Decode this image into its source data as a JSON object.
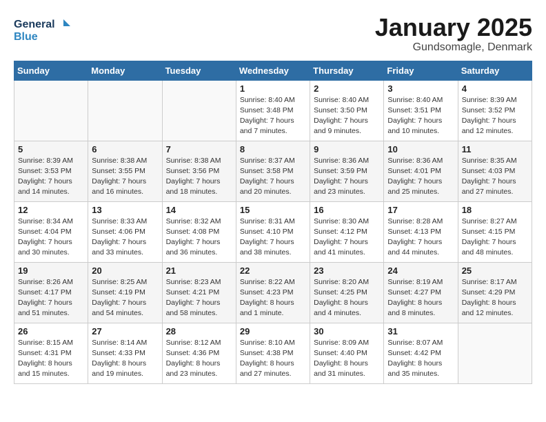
{
  "header": {
    "logo_line1": "General",
    "logo_line2": "Blue",
    "title": "January 2025",
    "subtitle": "Gundsomagle, Denmark"
  },
  "weekdays": [
    "Sunday",
    "Monday",
    "Tuesday",
    "Wednesday",
    "Thursday",
    "Friday",
    "Saturday"
  ],
  "weeks": [
    [
      {
        "day": "",
        "info": ""
      },
      {
        "day": "",
        "info": ""
      },
      {
        "day": "",
        "info": ""
      },
      {
        "day": "1",
        "info": "Sunrise: 8:40 AM\nSunset: 3:48 PM\nDaylight: 7 hours\nand 7 minutes."
      },
      {
        "day": "2",
        "info": "Sunrise: 8:40 AM\nSunset: 3:50 PM\nDaylight: 7 hours\nand 9 minutes."
      },
      {
        "day": "3",
        "info": "Sunrise: 8:40 AM\nSunset: 3:51 PM\nDaylight: 7 hours\nand 10 minutes."
      },
      {
        "day": "4",
        "info": "Sunrise: 8:39 AM\nSunset: 3:52 PM\nDaylight: 7 hours\nand 12 minutes."
      }
    ],
    [
      {
        "day": "5",
        "info": "Sunrise: 8:39 AM\nSunset: 3:53 PM\nDaylight: 7 hours\nand 14 minutes."
      },
      {
        "day": "6",
        "info": "Sunrise: 8:38 AM\nSunset: 3:55 PM\nDaylight: 7 hours\nand 16 minutes."
      },
      {
        "day": "7",
        "info": "Sunrise: 8:38 AM\nSunset: 3:56 PM\nDaylight: 7 hours\nand 18 minutes."
      },
      {
        "day": "8",
        "info": "Sunrise: 8:37 AM\nSunset: 3:58 PM\nDaylight: 7 hours\nand 20 minutes."
      },
      {
        "day": "9",
        "info": "Sunrise: 8:36 AM\nSunset: 3:59 PM\nDaylight: 7 hours\nand 23 minutes."
      },
      {
        "day": "10",
        "info": "Sunrise: 8:36 AM\nSunset: 4:01 PM\nDaylight: 7 hours\nand 25 minutes."
      },
      {
        "day": "11",
        "info": "Sunrise: 8:35 AM\nSunset: 4:03 PM\nDaylight: 7 hours\nand 27 minutes."
      }
    ],
    [
      {
        "day": "12",
        "info": "Sunrise: 8:34 AM\nSunset: 4:04 PM\nDaylight: 7 hours\nand 30 minutes."
      },
      {
        "day": "13",
        "info": "Sunrise: 8:33 AM\nSunset: 4:06 PM\nDaylight: 7 hours\nand 33 minutes."
      },
      {
        "day": "14",
        "info": "Sunrise: 8:32 AM\nSunset: 4:08 PM\nDaylight: 7 hours\nand 36 minutes."
      },
      {
        "day": "15",
        "info": "Sunrise: 8:31 AM\nSunset: 4:10 PM\nDaylight: 7 hours\nand 38 minutes."
      },
      {
        "day": "16",
        "info": "Sunrise: 8:30 AM\nSunset: 4:12 PM\nDaylight: 7 hours\nand 41 minutes."
      },
      {
        "day": "17",
        "info": "Sunrise: 8:28 AM\nSunset: 4:13 PM\nDaylight: 7 hours\nand 44 minutes."
      },
      {
        "day": "18",
        "info": "Sunrise: 8:27 AM\nSunset: 4:15 PM\nDaylight: 7 hours\nand 48 minutes."
      }
    ],
    [
      {
        "day": "19",
        "info": "Sunrise: 8:26 AM\nSunset: 4:17 PM\nDaylight: 7 hours\nand 51 minutes."
      },
      {
        "day": "20",
        "info": "Sunrise: 8:25 AM\nSunset: 4:19 PM\nDaylight: 7 hours\nand 54 minutes."
      },
      {
        "day": "21",
        "info": "Sunrise: 8:23 AM\nSunset: 4:21 PM\nDaylight: 7 hours\nand 58 minutes."
      },
      {
        "day": "22",
        "info": "Sunrise: 8:22 AM\nSunset: 4:23 PM\nDaylight: 8 hours\nand 1 minute."
      },
      {
        "day": "23",
        "info": "Sunrise: 8:20 AM\nSunset: 4:25 PM\nDaylight: 8 hours\nand 4 minutes."
      },
      {
        "day": "24",
        "info": "Sunrise: 8:19 AM\nSunset: 4:27 PM\nDaylight: 8 hours\nand 8 minutes."
      },
      {
        "day": "25",
        "info": "Sunrise: 8:17 AM\nSunset: 4:29 PM\nDaylight: 8 hours\nand 12 minutes."
      }
    ],
    [
      {
        "day": "26",
        "info": "Sunrise: 8:15 AM\nSunset: 4:31 PM\nDaylight: 8 hours\nand 15 minutes."
      },
      {
        "day": "27",
        "info": "Sunrise: 8:14 AM\nSunset: 4:33 PM\nDaylight: 8 hours\nand 19 minutes."
      },
      {
        "day": "28",
        "info": "Sunrise: 8:12 AM\nSunset: 4:36 PM\nDaylight: 8 hours\nand 23 minutes."
      },
      {
        "day": "29",
        "info": "Sunrise: 8:10 AM\nSunset: 4:38 PM\nDaylight: 8 hours\nand 27 minutes."
      },
      {
        "day": "30",
        "info": "Sunrise: 8:09 AM\nSunset: 4:40 PM\nDaylight: 8 hours\nand 31 minutes."
      },
      {
        "day": "31",
        "info": "Sunrise: 8:07 AM\nSunset: 4:42 PM\nDaylight: 8 hours\nand 35 minutes."
      },
      {
        "day": "",
        "info": ""
      }
    ]
  ]
}
